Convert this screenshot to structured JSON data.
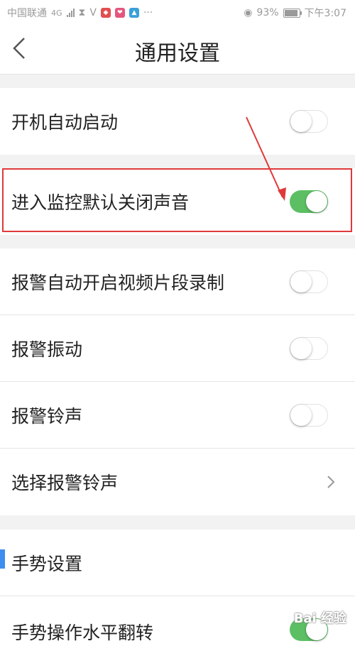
{
  "status_bar": {
    "carrier": "中国联通",
    "network": "4G",
    "battery": "93%",
    "time": "下午3:07"
  },
  "header": {
    "title": "通用设置"
  },
  "settings": [
    {
      "label": "开机自动启动",
      "control": "toggle",
      "checked": false
    },
    {
      "label": "进入监控默认关闭声音",
      "control": "toggle",
      "checked": true
    },
    {
      "label": "报警自动开启视频片段录制",
      "control": "toggle",
      "checked": false
    },
    {
      "label": "报警振动",
      "control": "toggle",
      "checked": false
    },
    {
      "label": "报警铃声",
      "control": "toggle",
      "checked": false
    },
    {
      "label": "选择报警铃声",
      "control": "chevron"
    }
  ],
  "gesture_section": {
    "title": "手势设置",
    "items": [
      {
        "label": "手势操作水平翻转",
        "control": "toggle",
        "checked": true
      }
    ]
  },
  "colors": {
    "toggle_on": "#5cbf64",
    "highlight_box": "#e0393a",
    "section_accent": "#3d8ef0"
  },
  "watermark": "Bai 经验"
}
